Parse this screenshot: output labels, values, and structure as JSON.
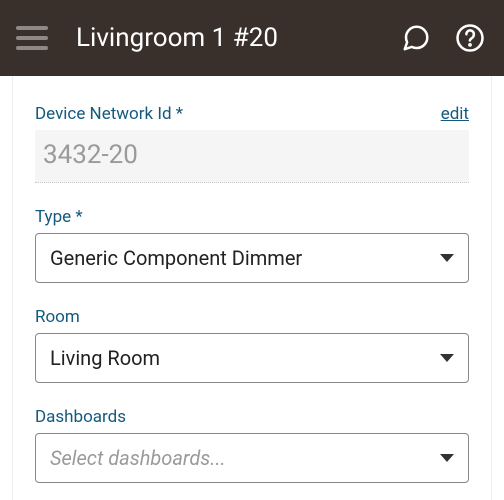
{
  "header": {
    "title": "Livingroom 1 #20"
  },
  "fields": {
    "deviceNetworkId": {
      "label": "Device Network Id *",
      "value": "3432-20",
      "editLink": "edit"
    },
    "type": {
      "label": "Type *",
      "value": "Generic Component Dimmer"
    },
    "room": {
      "label": "Room",
      "value": "Living Room"
    },
    "dashboards": {
      "label": "Dashboards",
      "placeholder": "Select dashboards..."
    }
  }
}
